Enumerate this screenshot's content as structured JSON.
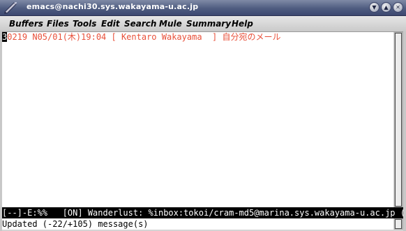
{
  "window": {
    "title": "emacs@nachi30.sys.wakayama-u.ac.jp",
    "buttons": {
      "menu_symbol": "▼",
      "minimize_symbol": "▲",
      "close_symbol": "✕"
    }
  },
  "menubar": {
    "items": [
      "Buffers",
      "Files",
      "Tools",
      "Edit",
      "Search",
      "Mule",
      "Summary",
      "Help"
    ]
  },
  "summary": {
    "cursor_char": "3",
    "line_rest": "0219 N05/01(木)19:04 [ Kentaro Wakayama  ] 自分宛のメール",
    "text_color": "#e8503a"
  },
  "modeline": {
    "text": "[--]-E:%%   [ON] Wanderlust: %inbox:tokoi/cram-md5@marina.sys.wakayama-u.ac.jp ("
  },
  "echo": {
    "text": "Updated (-22/+105) message(s)"
  }
}
